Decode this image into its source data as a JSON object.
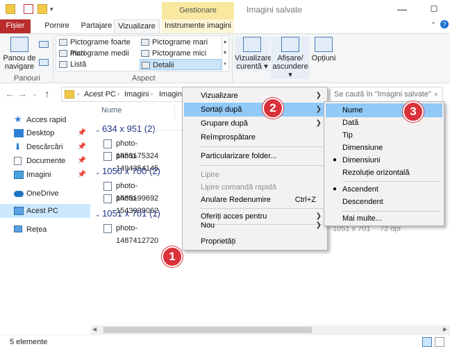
{
  "window": {
    "contextual_tab": "Gestionare",
    "title": "Imagini salvate",
    "minimize": "—",
    "maximize": "☐",
    "close": "✕"
  },
  "tabs": [
    "Fișier",
    "Pornire",
    "Partajare",
    "Vizualizare",
    "Instrumente imagini"
  ],
  "ribbon": {
    "panes_button": "Panou de navigare",
    "panes_group": "Panouri",
    "layout": [
      "Pictograme foarte mari",
      "Pictograme mari",
      "Pictograme medii",
      "Pictograme mici",
      "Listă",
      "Detalii"
    ],
    "layout_group": "Aspect",
    "current_view": "Vizualizare curentă",
    "show_hide": "Afișare/ ascundere",
    "options": "Opțiuni"
  },
  "address": {
    "crumbs": [
      "Acest PC",
      "Imagini",
      "Imagin"
    ],
    "search_placeholder": "Se caută în \"Imagini salvate\""
  },
  "nav": {
    "items": [
      {
        "label": "Acces rapid",
        "icon": "star-icon"
      },
      {
        "label": "Desktop",
        "icon": "desktop-icon"
      },
      {
        "label": "Descărcări",
        "icon": "download-icon"
      },
      {
        "label": "Documente",
        "icon": "document-icon"
      },
      {
        "label": "Imagini",
        "icon": "pictures-icon"
      },
      {
        "label": "OneDrive",
        "icon": "cloud-icon"
      },
      {
        "label": "Acest PC",
        "icon": "computer-icon"
      },
      {
        "label": "Rețea",
        "icon": "network-icon"
      }
    ]
  },
  "content": {
    "col_name": "Nume",
    "groups": [
      {
        "title": "634 x 951 (2)",
        "files": [
          "photo-1453175324",
          "photo-1494354145"
        ]
      },
      {
        "title": "1050 x 700 (2)",
        "files": [
          "photo-1485199692",
          "photo-1543909062"
        ]
      },
      {
        "title": "1051 x 701 (1)",
        "files": [
          "photo-1487412720"
        ]
      }
    ],
    "ghost_dims": "1051 x 701",
    "ghost_dpi": "72 dpi"
  },
  "status": "5 elemente",
  "menu": {
    "items": [
      "Vizualizare",
      "Sortați după",
      "Grupare după",
      "Reîmprospătare",
      "Particularizare folder...",
      "Lipire",
      "Lipire comandă rapidă",
      "Anulare Redenumire",
      "Oferiți acces pentru",
      "Nou",
      "Proprietăți"
    ],
    "undo_shortcut": "Ctrl+Z"
  },
  "submenu": {
    "items": [
      "Nume",
      "Dată",
      "Tip",
      "Dimensiune",
      "Dimensiuni",
      "Rezoluție orizontală",
      "Ascendent",
      "Descendent",
      "Mai multe..."
    ]
  },
  "badges": [
    "1",
    "2",
    "3"
  ]
}
